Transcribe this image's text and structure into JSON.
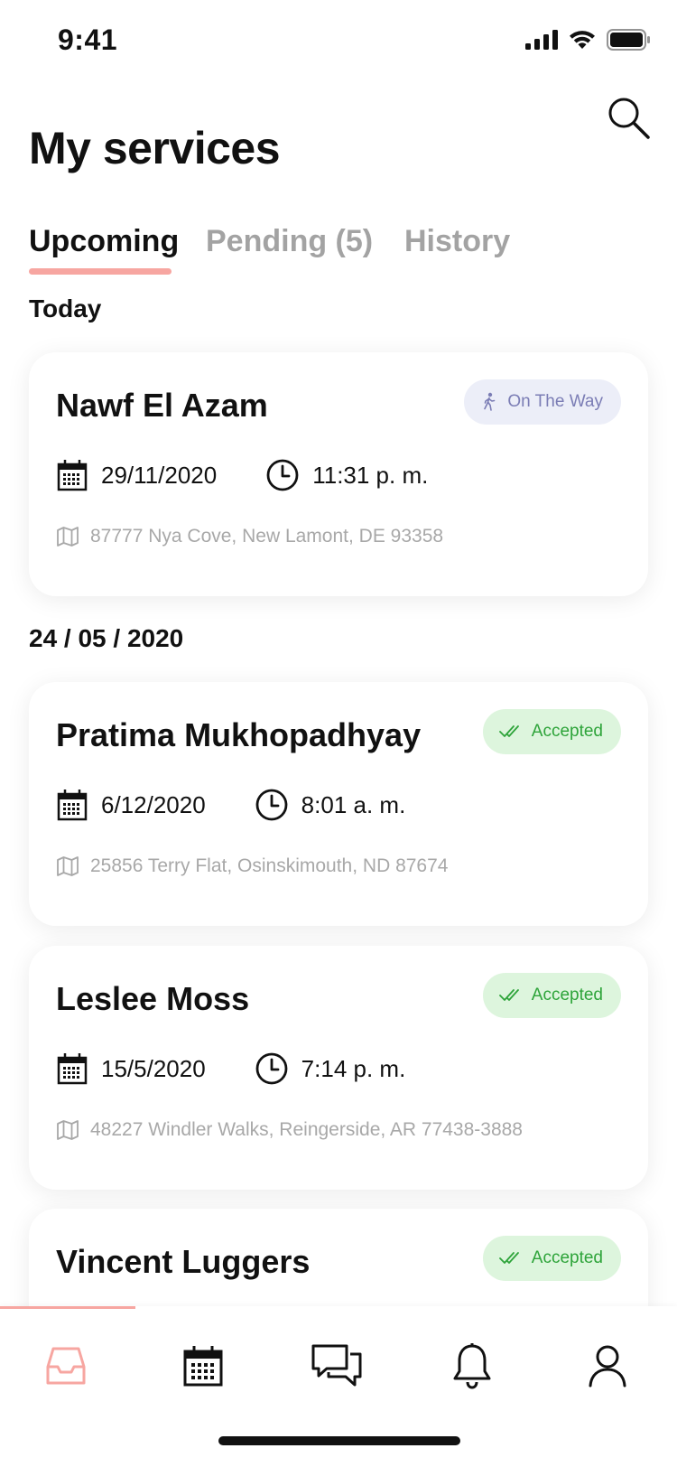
{
  "status_bar": {
    "time": "9:41"
  },
  "page": {
    "title": "My services"
  },
  "tabs": [
    {
      "label": "Upcoming",
      "active": true
    },
    {
      "label": "Pending (5)",
      "active": false
    },
    {
      "label": "History",
      "active": false
    }
  ],
  "sections": [
    {
      "label": "Today"
    },
    {
      "label": "24 / 05 / 2020"
    }
  ],
  "services": [
    {
      "name": "Nawf El Azam",
      "status": "On The Way",
      "status_icon": "walking-person-icon",
      "date": "29/11/2020",
      "time": "11:31 p. m.",
      "address": "87777 Nya Cove, New Lamont, DE 93358"
    },
    {
      "name": "Pratima Mukhopadhyay",
      "status": "Accepted",
      "status_icon": "double-check-icon",
      "date": "6/12/2020",
      "time": "8:01 a. m.",
      "address": "25856 Terry Flat, Osinskimouth, ND 87674"
    },
    {
      "name": "Leslee Moss",
      "status": "Accepted",
      "status_icon": "double-check-icon",
      "date": "15/5/2020",
      "time": "7:14 p. m.",
      "address": "48227 Windler Walks, Reingerside, AR 77438-3888"
    },
    {
      "name": "Vincent Luggers",
      "status": "Accepted",
      "status_icon": "double-check-icon"
    }
  ],
  "bottom_nav": [
    {
      "icon": "inbox-icon",
      "active": true
    },
    {
      "icon": "calendar-icon",
      "active": false
    },
    {
      "icon": "chat-icon",
      "active": false
    },
    {
      "icon": "bell-icon",
      "active": false
    },
    {
      "icon": "profile-icon",
      "active": false
    }
  ],
  "colors": {
    "accent": "#f7a6a1",
    "on_the_way_bg": "#eceef8",
    "on_the_way_text": "#7b7db5",
    "accepted_bg": "#ddf5dd",
    "accepted_text": "#2ea43a",
    "muted_text": "#a8a8a8"
  }
}
